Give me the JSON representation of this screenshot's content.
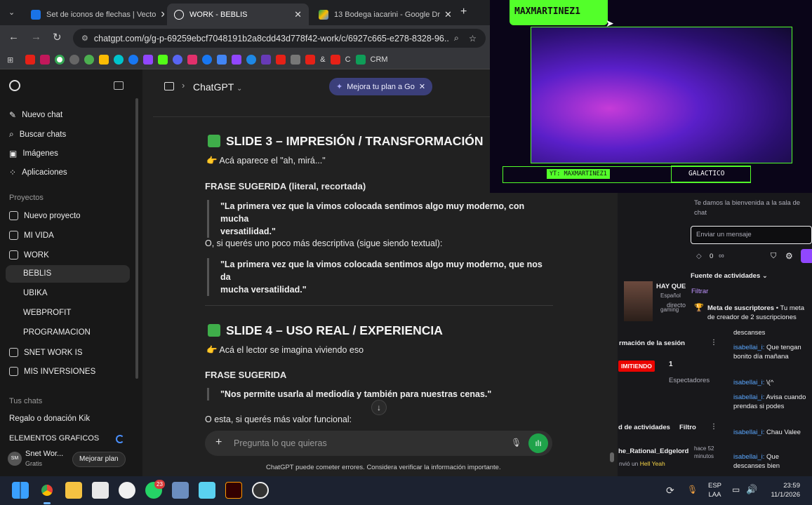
{
  "browser": {
    "tabs": [
      {
        "title": "Set de iconos de flechas | Vecto",
        "color": "#1a73e8"
      },
      {
        "title": "WORK - BEBLIS",
        "color": "#ffffff"
      },
      {
        "title": "13 Bodega iacarini - Google Dr",
        "color": "#fbbc04"
      }
    ],
    "url": "chatgpt.com/g/g-p-69259ebcf7048191b2a8cdd43d778f42-work/c/6927c665-e278-8328-96...",
    "bookmarks": {
      "amp_label": "&",
      "c_label": "C",
      "crm_label": "CRM"
    }
  },
  "sidebar": {
    "top_items": [
      "Nuevo chat",
      "Buscar chats",
      "Imágenes",
      "Aplicaciones"
    ],
    "projects_heading": "Proyectos",
    "projects": [
      "Nuevo proyecto",
      "MI VIDA",
      "WORK",
      "BEBLIS",
      "UBIKA",
      "WEBPROFIT",
      "PROGRAMACION",
      "SNET WORK IS",
      "MIS INVERSIONES"
    ],
    "chats_heading": "Tus chats",
    "chats": [
      "Regalo o donación Kik",
      "ELEMENTOS GRAFICOS"
    ],
    "user": {
      "initials": "SM",
      "name": "Snet Wor...",
      "plan": "Gratis",
      "upgrade_label": "Mejorar plan"
    }
  },
  "header": {
    "model": "ChatGPT",
    "upgrade_pill": "Mejora tu plan a Go"
  },
  "content": {
    "slide3_title": "SLIDE 3 – IMPRESIÓN / TRANSFORMACIÓN",
    "slide3_sub": "Acá aparece el \"ah, mirá...\"",
    "frase_literal": "FRASE SUGERIDA (literal, recortada)",
    "quote1_l1": "\"La primera vez que la vimos colocada sentimos algo muy moderno, con mucha",
    "quote1_l2": "versatilidad.\"",
    "alt1": "O, si querés uno poco más descriptiva (sigue siendo textual):",
    "quote2_l1": "\"La primera vez que la vimos colocada sentimos algo muy moderno, que nos da",
    "quote2_l2": "mucha versatilidad.\"",
    "slide4_title": "SLIDE 4 – USO REAL / EXPERIENCIA",
    "slide4_sub": "Acá el lector se imagina viviendo eso",
    "frase": "FRASE SUGERIDA",
    "quote3": "\"Nos permite usarla al mediodía y también para nuestras cenas.\"",
    "alt2": "O esta, si querés más valor funcional:"
  },
  "composer": {
    "placeholder": "Pregunta lo que quieras",
    "disclaimer": "ChatGPT puede cometer errores. Considera verificar la información importante."
  },
  "stream": {
    "name": "MAXMARTINEZ1",
    "yt": "YT: MAXMARTINEZ1",
    "tag": "GALACTICO"
  },
  "twitch": {
    "welcome": "Te damos la bienvenida a la sala de chat",
    "input_placeholder": "Enviar un mensaje",
    "points": "0",
    "infinity": "∞",
    "activity_feed": "Fuente de actividades",
    "filter": "Filtrar",
    "hay_que": "HAY QUE",
    "espanol": "Español",
    "directo": "directo",
    "gaming": "gaming",
    "meta_title": "Meta de suscriptores",
    "meta_text": "• Tu meta de creador de 2 suscripciones",
    "session_info": "rmación de la sesión",
    "live_badge": "IMITIENDO",
    "viewers": "1",
    "viewers_label": "Espectadores",
    "activities": "d de actividades",
    "filtro": "Filtro",
    "event_user": "he_Rational_Edgelord",
    "event_time": "hace 52 minutos",
    "event_text": "nvió un",
    "event_highlight": "Hell Yeah",
    "messages": [
      {
        "user": "",
        "text": "descanses"
      },
      {
        "user": "isabellai_i:",
        "text": "Que tengan bonito día mañana"
      },
      {
        "user": "isabellai_i:",
        "text": "\\(^"
      },
      {
        "user": "isabellai_i:",
        "text": "Avisa cuando prendas si podes"
      },
      {
        "user": "isabellai_i:",
        "text": "Chau Valee"
      },
      {
        "user": "isabellai_i:",
        "text": "Que descanses bien"
      }
    ]
  },
  "taskbar": {
    "lang1": "ESP",
    "lang2": "LAA",
    "time": "23:59",
    "date": "11/1/2026",
    "badge": "23"
  }
}
